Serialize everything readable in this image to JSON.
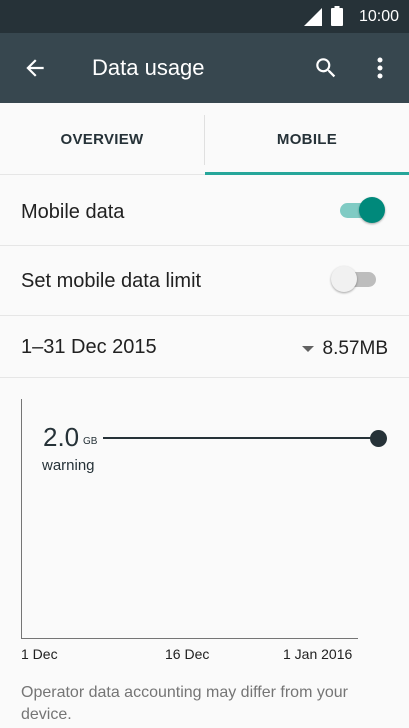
{
  "status_bar": {
    "time": "10:00",
    "icons": [
      "signal-icon",
      "battery-icon"
    ]
  },
  "app_bar": {
    "title": "Data usage",
    "icons": [
      "back-arrow-icon",
      "search-icon",
      "more-vert-icon"
    ]
  },
  "tabs": [
    {
      "label": "OVERVIEW",
      "selected": false
    },
    {
      "label": "MOBILE",
      "selected": true
    }
  ],
  "settings": {
    "mobile_data": {
      "label": "Mobile data",
      "enabled": true
    },
    "data_limit": {
      "label": "Set mobile data limit",
      "enabled": false
    }
  },
  "cycle": {
    "range": "1–31 Dec 2015",
    "usage": "8.57MB"
  },
  "chart": {
    "warning_value": "2.0",
    "warning_unit": "GB",
    "warning_label": "warning",
    "x_ticks": [
      "1 Dec",
      "16 Dec",
      "1 Jan 2016"
    ]
  },
  "footnote": "Operator data accounting may differ from your device.",
  "colors": {
    "app_bar": "#37474f",
    "status_bar": "#263238",
    "accent": "#26a69a"
  }
}
